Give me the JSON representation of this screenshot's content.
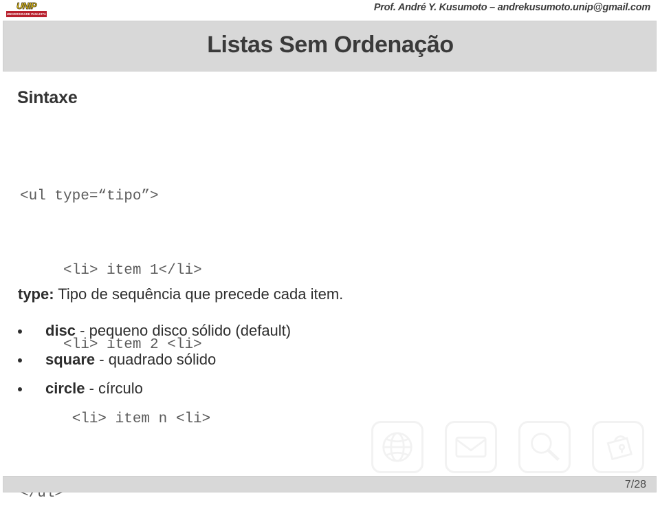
{
  "header": {
    "logo": {
      "word": "UNIP",
      "banner": "UNIVERSIDADE PAULISTA",
      "word_color": "#f7d417",
      "banner_color": "#b8202e"
    },
    "author": "Prof. André Y. Kusumoto – andrekusumoto.unip@gmail.com"
  },
  "title": {
    "text": "Listas Sem Ordenação",
    "band_color": "#d8d8d8",
    "text_color": "#3a3a3a"
  },
  "content": {
    "section_heading": "Sintaxe",
    "code_lines": [
      "<ul type=“tipo”>",
      "     <li> item 1</li>",
      "     <li> item 2 <li>",
      "      <li> item n <li>",
      "</ul>"
    ],
    "lead": {
      "keyword": "type:",
      "rest": " Tipo de sequência que precede cada item."
    },
    "bullets": [
      {
        "keyword": "disc",
        "rest": " - pequeno disco sólido (default)"
      },
      {
        "keyword": "square",
        "rest": " - quadrado sólido"
      },
      {
        "keyword": "circle",
        "rest": " - círculo"
      }
    ]
  },
  "watermarks": [
    {
      "name": "globe-icon"
    },
    {
      "name": "envelope-icon"
    },
    {
      "name": "magnifier-icon"
    },
    {
      "name": "lock-bag-icon"
    }
  ],
  "footer": {
    "page": "7/28",
    "band_color": "#d8d8d8"
  }
}
